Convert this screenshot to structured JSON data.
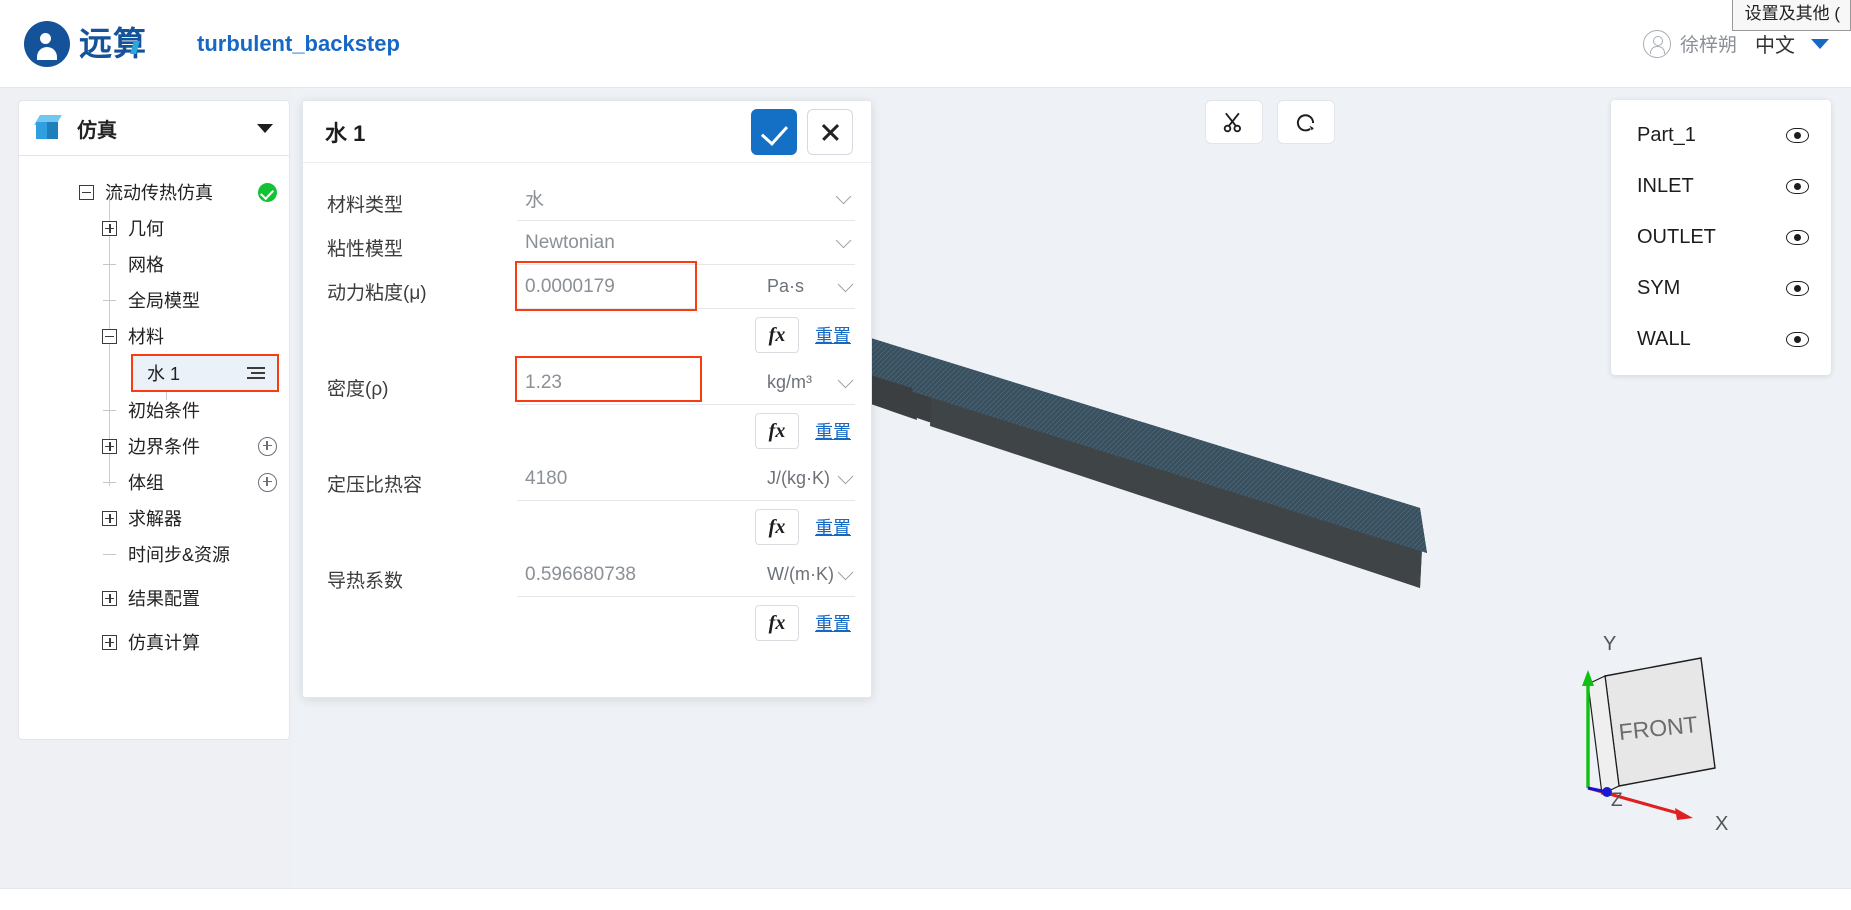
{
  "topbar": {
    "brand_text": "远算",
    "project_title": "turbulent_backstep",
    "user_name": "徐梓朔",
    "language": "中文",
    "browser_tooltip": "设置及其他 (",
    "brand_color": "#14539a",
    "title_color": "#1668c4"
  },
  "sidebar": {
    "header_title": "仿真",
    "tree": [
      {
        "label": "流动传热仿真",
        "toggle": "minus",
        "depth": 0,
        "status": "ok"
      },
      {
        "label": "几何",
        "toggle": "plus",
        "depth": 1
      },
      {
        "label": "网格",
        "toggle": "stub",
        "depth": 1
      },
      {
        "label": "全局模型",
        "toggle": "stub",
        "depth": 1
      },
      {
        "label": "材料",
        "toggle": "minus",
        "depth": 1
      },
      {
        "label": "水 1",
        "toggle": "stub",
        "depth": 2,
        "selected": true,
        "menu": true
      },
      {
        "label": "初始条件",
        "toggle": "stub",
        "depth": 1
      },
      {
        "label": "边界条件",
        "toggle": "plus",
        "depth": 1,
        "add": true
      },
      {
        "label": "体组",
        "toggle": "stub",
        "depth": 1,
        "add": true
      },
      {
        "label": "求解器",
        "toggle": "plus",
        "depth": 1
      },
      {
        "label": "时间步&资源",
        "toggle": "stub",
        "depth": 1
      },
      {
        "label": "结果配置",
        "toggle": "plus",
        "depth": 1
      },
      {
        "label": "仿真计算",
        "toggle": "plus",
        "depth": 1
      }
    ]
  },
  "dialog": {
    "title": "水 1",
    "confirm_label": "confirm",
    "cancel_label": "cancel",
    "reset_label": "重置",
    "fx_label": "fx",
    "fields": [
      {
        "label": "材料类型",
        "value": "水",
        "kind": "select"
      },
      {
        "label": "粘性模型",
        "value": "Newtonian",
        "kind": "select"
      },
      {
        "label": "动力粘度(μ)",
        "value": "0.0000179",
        "unit": "Pa·s",
        "kind": "input",
        "highlight": true,
        "fx": true
      },
      {
        "label": "密度(ρ)",
        "value": "1.23",
        "unit": "kg/m³",
        "kind": "input",
        "highlight": true,
        "fx": true
      },
      {
        "label": "定压比热容",
        "value": "4180",
        "unit": "J/(kg·K)",
        "kind": "input",
        "fx": true
      },
      {
        "label": "导热系数",
        "value": "0.596680738",
        "unit": "W/(m·K)",
        "kind": "input",
        "fx": true
      }
    ],
    "highlight_color": "#fa3c12"
  },
  "viewport": {
    "tools": [
      {
        "name": "clip-scissors",
        "glyph": "✂"
      },
      {
        "name": "reset-rotate",
        "glyph": "↻"
      }
    ],
    "parts": [
      {
        "label": "Part_1"
      },
      {
        "label": "INLET"
      },
      {
        "label": "OUTLET"
      },
      {
        "label": "SYM"
      },
      {
        "label": "WALL"
      }
    ],
    "triad": {
      "x_label": "X",
      "y_label": "Y",
      "z_label": "Z",
      "face_label": "FRONT",
      "x_color": "#e02020",
      "y_color": "#11c011",
      "z_color": "#1414c8"
    },
    "mesh_color": "#3e5260",
    "background": "#eef1f5"
  }
}
